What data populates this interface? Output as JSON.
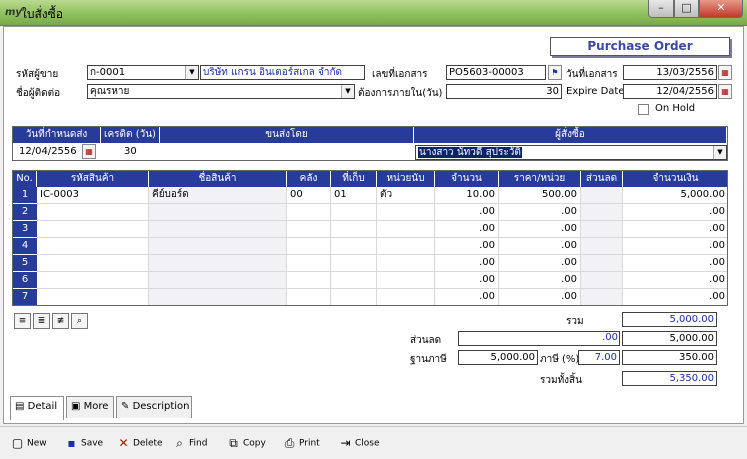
{
  "window": {
    "app_badge": "my",
    "title": "ใบสั่งซื้อ",
    "min_glyph": "–",
    "max_glyph": "□",
    "close_glyph": "✕"
  },
  "header": {
    "doc_type": "Purchase Order",
    "vendor_code_label": "รหัสผู้ขาย",
    "vendor_code": "ก-0001",
    "vendor_name": "บริษัท แกรน อินเตอร์สเกล จำกัด",
    "doc_no_label": "เลขที่เอกสาร",
    "doc_no": "PO5603-00003",
    "doc_date_label": "วันที่เอกสาร",
    "doc_date": "13/03/2556",
    "contact_label": "ชื่อผู้ติดต่อ",
    "contact": "คุณรหาย",
    "need_days_label": "ต้องการภายใน(วัน)",
    "need_days": "30",
    "expire_label": "Expire Date",
    "expire_date": "12/04/2556",
    "onhold_label": "On Hold"
  },
  "delivery": {
    "headers": [
      "วันที่กำหนดส่ง",
      "เครดิต (วัน)",
      "ขนส่งโดย",
      "ผู้สั่งซื้อ"
    ],
    "due_date": "12/04/2556",
    "credit_days": "30",
    "ship_by": "",
    "orderer": "นางสาว นัทวดี สุประวัติ"
  },
  "grid": {
    "columns": [
      "No.",
      "รหัสสินค้า",
      "ชื่อสินค้า",
      "คลัง",
      "ที่เก็บ",
      "หน่วยนับ",
      "จำนวน",
      "ราคา/หน่วย",
      "ส่วนลด",
      "จำนวนเงิน"
    ],
    "rows": [
      {
        "no": "1",
        "code": "IC-0003",
        "name": "คีย์บอร์ด",
        "wh": "00",
        "loc": "01",
        "unit": "ตัว",
        "qty": "10.00",
        "price": "500.00",
        "disc": "",
        "amount": "5,000.00"
      },
      {
        "no": "2",
        "code": "",
        "name": "",
        "wh": "",
        "loc": "",
        "unit": "",
        "qty": ".00",
        "price": ".00",
        "disc": "",
        "amount": ".00"
      },
      {
        "no": "3",
        "code": "",
        "name": "",
        "wh": "",
        "loc": "",
        "unit": "",
        "qty": ".00",
        "price": ".00",
        "disc": "",
        "amount": ".00"
      },
      {
        "no": "4",
        "code": "",
        "name": "",
        "wh": "",
        "loc": "",
        "unit": "",
        "qty": ".00",
        "price": ".00",
        "disc": "",
        "amount": ".00"
      },
      {
        "no": "5",
        "code": "",
        "name": "",
        "wh": "",
        "loc": "",
        "unit": "",
        "qty": ".00",
        "price": ".00",
        "disc": "",
        "amount": ".00"
      },
      {
        "no": "6",
        "code": "",
        "name": "",
        "wh": "",
        "loc": "",
        "unit": "",
        "qty": ".00",
        "price": ".00",
        "disc": "",
        "amount": ".00"
      },
      {
        "no": "7",
        "code": "",
        "name": "",
        "wh": "",
        "loc": "",
        "unit": "",
        "qty": ".00",
        "price": ".00",
        "disc": "",
        "amount": ".00"
      }
    ]
  },
  "totals": {
    "sum_label": "รวม",
    "sum": "5,000.00",
    "discount_label": "ส่วนลด",
    "discount_input": "",
    "discount_value": ".00",
    "after_discount": "5,000.00",
    "tax_base_label": "ฐานภาษี",
    "tax_base": "5,000.00",
    "vat_label": "ภาษี (%)",
    "vat_rate": "7.00",
    "vat_amount": "350.00",
    "grand_label": "รวมทั้งสิ้น",
    "grand_total": "5,350.00"
  },
  "tabs": [
    "Detail",
    "More",
    "Description"
  ],
  "toolbar": [
    "New",
    "Save",
    "Delete",
    "Find",
    "Copy",
    "Print",
    "Close"
  ],
  "colors": {
    "header_blue": "#273b9a",
    "titlebar_green": "#8cbf5a",
    "text_blue": "#1a2fa8"
  }
}
